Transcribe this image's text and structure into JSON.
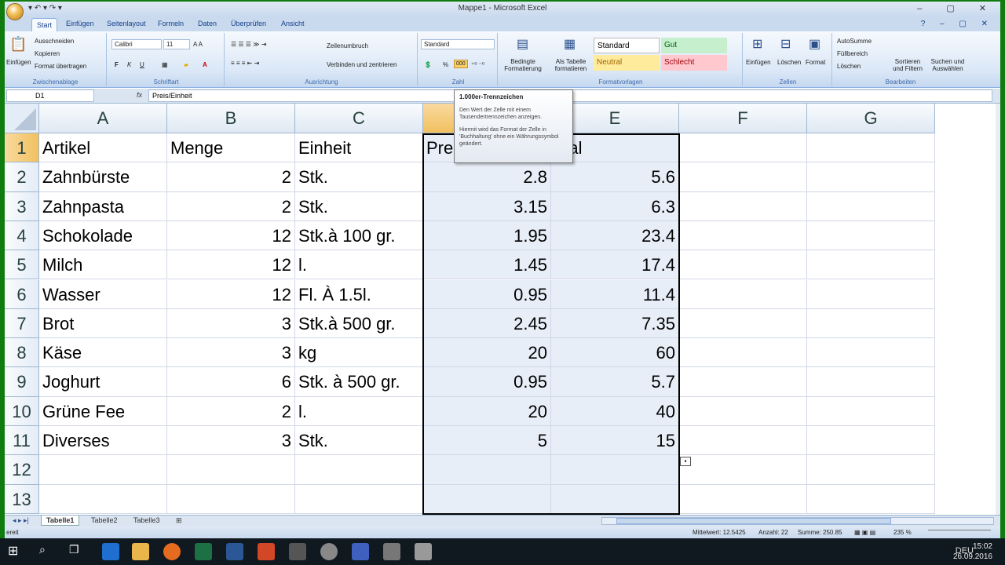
{
  "app": {
    "title": "Mappe1 - Microsoft Excel",
    "qat": "▾ ↶ ▾ ↷ ▾",
    "tabs": [
      "Start",
      "Einfügen",
      "Seitenlayout",
      "Formeln",
      "Daten",
      "Überprüfen",
      "Ansicht"
    ],
    "active_tab": "Start"
  },
  "ribbon": {
    "clipboard": {
      "paste": "Einfügen",
      "cut": "Ausschneiden",
      "copy": "Kopieren",
      "format_painter": "Format übertragen",
      "label": "Zwischenablage"
    },
    "font": {
      "name": "Calibri",
      "size": "11",
      "bold": "F",
      "italic": "K",
      "underline": "U",
      "label": "Schriftart"
    },
    "alignment": {
      "wrap": "Zeilenumbruch",
      "merge": "Verbinden und zentrieren",
      "label": "Ausrichtung"
    },
    "number": {
      "format": "Standard",
      "percent": "%",
      "thousands": "000",
      "label": "Zahl"
    },
    "styles": {
      "conditional": "Bedingte Formatierung",
      "as_table": "Als Tabelle formatieren",
      "standard": "Standard",
      "gut": "Gut",
      "neutral": "Neutral",
      "schlecht": "Schlecht",
      "label": "Formatvorlagen"
    },
    "cells": {
      "insert": "Einfügen",
      "delete": "Löschen",
      "format": "Format",
      "label": "Zellen"
    },
    "editing": {
      "autosum": "AutoSumme",
      "fill": "Füllbereich",
      "clear": "Löschen",
      "sort": "Sortieren und Filtern",
      "find": "Suchen und Auswählen",
      "label": "Bearbeiten"
    }
  },
  "formula_bar": {
    "name_box": "D1",
    "fx": "fx",
    "formula": "Preis/Einheit"
  },
  "tooltip": {
    "title": "1.000er-Trennzeichen",
    "line1": "Den Wert der Zelle mit einem Tausendertrennzeichen anzeigen.",
    "line2": "Hiermit wird das Format der Zelle in 'Buchhaltung' ohne ein Währungssymbol geändert."
  },
  "sheet": {
    "columns": [
      "A",
      "B",
      "C",
      "D",
      "E",
      "F",
      "G"
    ],
    "row_numbers": [
      "1",
      "2",
      "3",
      "4",
      "5",
      "6",
      "7",
      "8",
      "9",
      "10",
      "11",
      "12",
      "13"
    ],
    "rows": [
      [
        "Artikel",
        "Menge",
        "Einheit",
        "Pre",
        "otal"
      ],
      [
        "Zahnbürste",
        "2",
        "Stk.",
        "2.8",
        "5.6"
      ],
      [
        "Zahnpasta",
        "2",
        "Stk.",
        "3.15",
        "6.3"
      ],
      [
        "Schokolade",
        "12",
        "Stk.à 100 gr.",
        "1.95",
        "23.4"
      ],
      [
        "Milch",
        "12",
        "l.",
        "1.45",
        "17.4"
      ],
      [
        "Wasser",
        "12",
        "Fl. À 1.5l.",
        "0.95",
        "11.4"
      ],
      [
        "Brot",
        "3",
        "Stk.à 500 gr.",
        "2.45",
        "7.35"
      ],
      [
        "Käse",
        "3",
        "kg",
        "20",
        "60"
      ],
      [
        "Joghurt",
        "6",
        "Stk. à 500 gr.",
        "0.95",
        "5.7"
      ],
      [
        "Grüne Fee",
        "2",
        "l.",
        "20",
        "40"
      ],
      [
        "Diverses",
        "3",
        "Stk.",
        "5",
        "15"
      ],
      [
        "",
        "",
        "",
        "",
        ""
      ],
      [
        "",
        "",
        "",
        "",
        ""
      ]
    ]
  },
  "sheet_tabs": [
    "Tabelle1",
    "Tabelle2",
    "Tabelle3"
  ],
  "status": {
    "mode": "ereit",
    "average": "Mittelwert: 12.5425",
    "count": "Anzahl: 22",
    "sum": "Summe: 250.85",
    "zoom": "235 %"
  },
  "taskbar": {
    "lang": "DEU",
    "time": "15:02",
    "date": "26.09.2016"
  }
}
